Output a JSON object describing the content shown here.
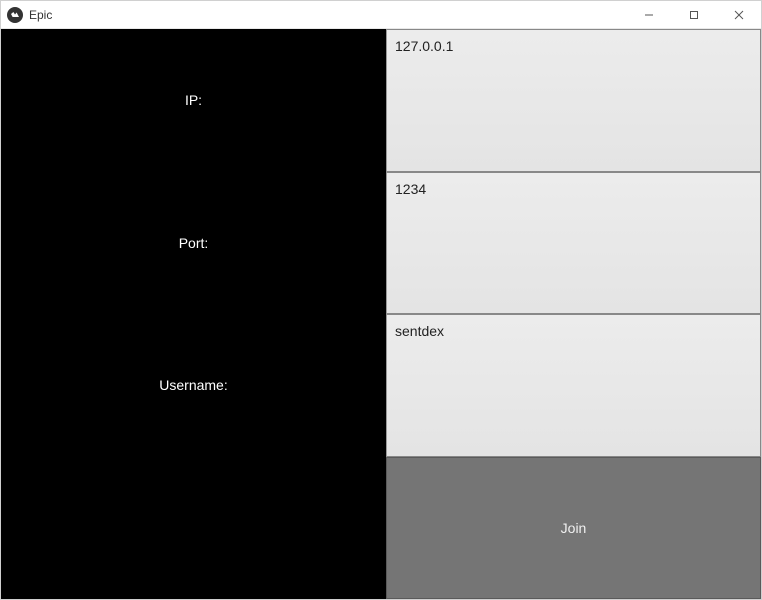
{
  "window": {
    "title": "Epic"
  },
  "form": {
    "ip": {
      "label": "IP:",
      "value": "127.0.0.1"
    },
    "port": {
      "label": "Port:",
      "value": "1234"
    },
    "username": {
      "label": "Username:",
      "value": "sentdex"
    },
    "join_button": "Join"
  },
  "colors": {
    "label_bg": "#000000",
    "label_fg": "#ffffff",
    "input_bg": "#ececec",
    "button_bg": "#757575",
    "button_fg": "#f0f0f0"
  }
}
